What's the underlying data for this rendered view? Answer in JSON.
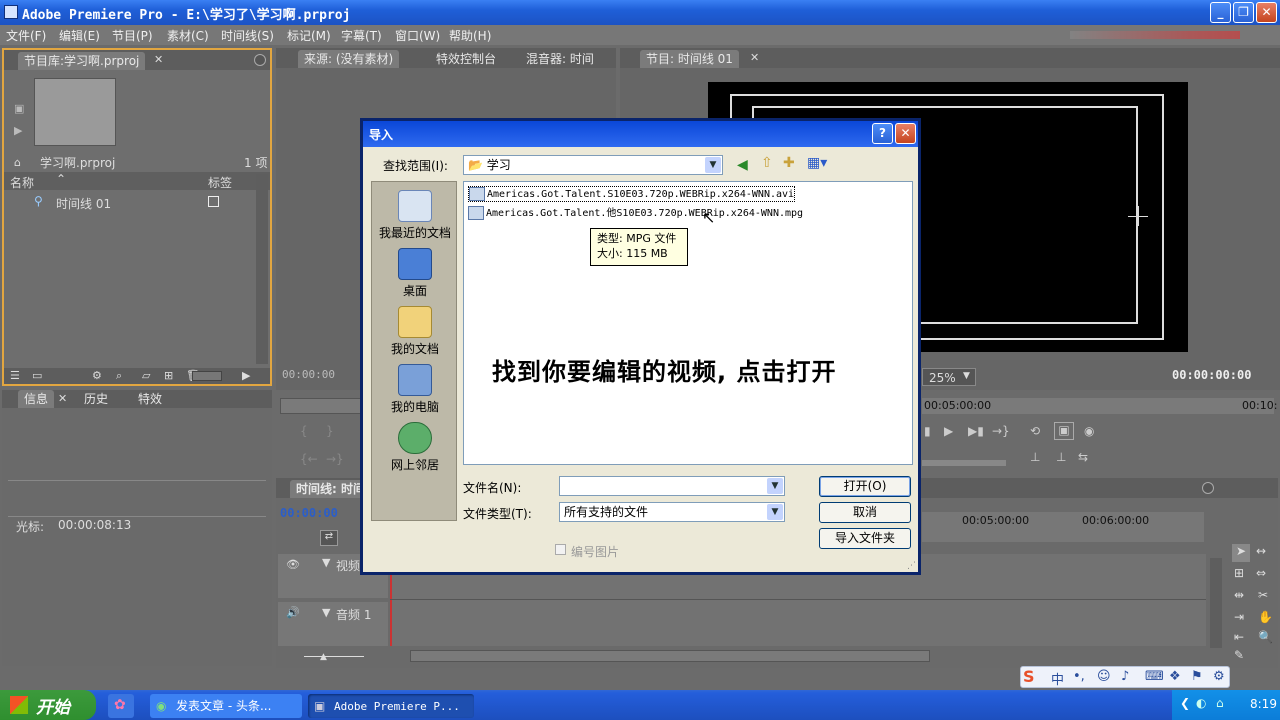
{
  "window": {
    "title": "Adobe Premiere Pro - E:\\学习了\\学习啊.prproj"
  },
  "menu": [
    "文件(F)",
    "编辑(E)",
    "节目(P)",
    "素材(C)",
    "时间线(S)",
    "标记(M)",
    "字幕(T)",
    "窗口(W)",
    "帮助(H)"
  ],
  "project": {
    "tab": "节目库:学习啊.prproj",
    "filename": "学习啊.prproj",
    "count": "1 项",
    "col_name": "名称",
    "col_label": "标签",
    "item": "时间线 01"
  },
  "source": {
    "tabs": [
      "来源: (没有素材)",
      "特效控制台",
      "混音器: 时间"
    ],
    "timecode": "00:00:00"
  },
  "program": {
    "tab": "节目: 时间线 01",
    "zoom": "25%",
    "timecode": "00:00:00:00",
    "ruler": [
      "00:05:00:00",
      "00:10:"
    ]
  },
  "info": {
    "tabs": [
      "信息",
      "历史",
      "特效"
    ],
    "cursor_label": "光标:",
    "cursor_value": "00:00:08:13"
  },
  "timeline": {
    "tab": "时间线: 时间",
    "timecode": "00:00:00",
    "ruler": [
      "00:05:00:00",
      "00:06:00:00"
    ],
    "video_track": "视频",
    "audio_track": "音频 1"
  },
  "dialog": {
    "title": "导入",
    "lookin_label": "查找范围(I):",
    "lookin_value": "学习",
    "places": [
      "我最近的文档",
      "桌面",
      "我的文档",
      "我的电脑",
      "网上邻居"
    ],
    "files": [
      "Americas.Got.Talent.S10E03.720p.WEBRip.x264-WNN.avi",
      "Americas.Got.Talent.他S10E03.720p.WEBRip.x264-WNN.mpg"
    ],
    "tooltip_type": "类型: MPG 文件",
    "tooltip_size": "大小: 115 MB",
    "filename_label": "文件名(N):",
    "filename_value": "",
    "filetype_label": "文件类型(T):",
    "filetype_value": "所有支持的文件",
    "numbered_label": "编号图片",
    "open_label": "打开(O)",
    "cancel_label": "取消",
    "import_folder_label": "导入文件夹"
  },
  "overlay_caption": "找到你要编辑的视频, 点击打开",
  "taskbar": {
    "start": "开始",
    "items": [
      "发表文章 - 头条...",
      "Adobe Premiere P..."
    ],
    "clock": "8:19"
  },
  "colors": {
    "accent": "#e2a640",
    "xp_blue": "#245edb",
    "dialog_bg": "#ece9d8"
  }
}
